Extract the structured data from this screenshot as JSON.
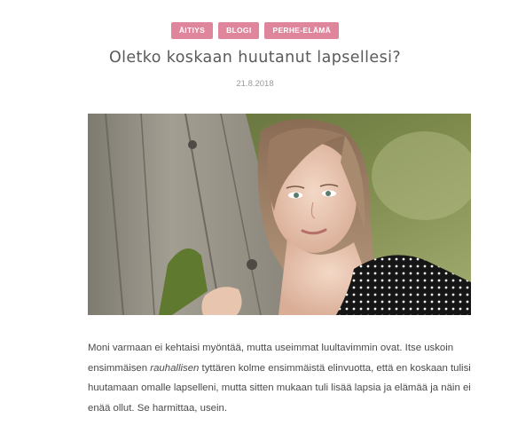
{
  "post": {
    "tags": [
      {
        "label": "ÄITIYS"
      },
      {
        "label": "BLOGI"
      },
      {
        "label": "PERHE-ELÄMÄ"
      }
    ],
    "title": "Oletko koskaan huutanut lapsellesi?",
    "date": "21.8.2018",
    "paragraph": {
      "part1": "Moni varmaan ei kehtaisi myöntää, mutta useimmat luultavimmin ovat. Itse uskoin ensimmäisen ",
      "emphasis": "rauhallisen",
      "part2": " tyttären kolme ensimmäistä elinvuotta, että en koskaan tulisi huutamaan omalle lapselleni, mutta sitten mukaan tuli lisää lapsia ja elämää ja näin ei enää ollut. Se harmittaa, usein."
    }
  },
  "colors": {
    "tag_background": "#e0869c",
    "title_text": "#5a5a5a",
    "date_text": "#9a9a9a",
    "body_text": "#4a4a4a"
  }
}
